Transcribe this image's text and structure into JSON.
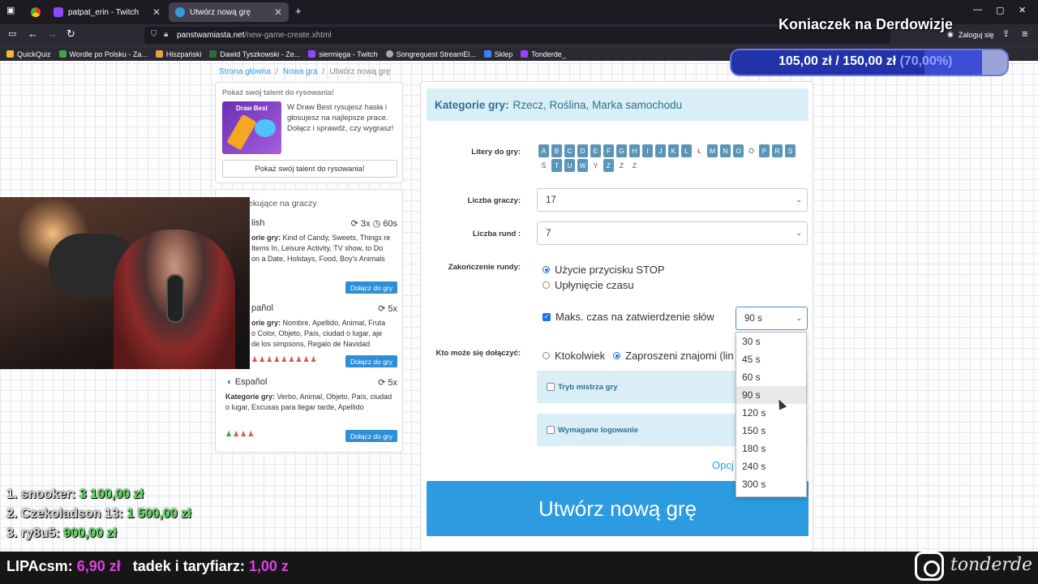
{
  "browser": {
    "tabs": [
      {
        "label": "patpat_erin - Twitch"
      },
      {
        "label": "Utwórz nową grę"
      }
    ],
    "url_host": "panstwamiasta.net",
    "url_path": "/new-game-create.xhtml",
    "login_label": "Zaloguj się",
    "bookmarks": [
      "QuickQuiz",
      "Wordle po Polsku - Za...",
      "Hiszpański",
      "Dawid Tyszkowski - Ze...",
      "siermięga - Twitch",
      "Songrequest StreamEl...",
      "Sklep",
      "Tonderde_"
    ]
  },
  "overlay": {
    "stream_title": "Koniaczek na Derdowizje",
    "goal_current": "105,00 zł",
    "goal_sep": "/",
    "goal_target": "150,00 zł",
    "goal_pct_label": "(70,00%)",
    "goal_fraction": 0.7,
    "leaderboard": [
      {
        "rank": "1.",
        "name": "snooker:",
        "amount": "3 100,00 zł"
      },
      {
        "rank": "2.",
        "name": "Czekoladson 13:",
        "amount": "1 500,00 zł"
      },
      {
        "rank": "3.",
        "name": "ry8u5:",
        "amount": "900,00 zł"
      }
    ],
    "donors": [
      {
        "name": "LIPAcsm:",
        "amount": "6,90 zł"
      },
      {
        "name": "tadek i taryfiarz:",
        "amount": "1,00 z"
      }
    ],
    "instagram": "tonderde"
  },
  "breadcrumb": [
    "Strona główna",
    "Nowa gra",
    "Utwórz nową grę"
  ],
  "promo": {
    "title": "Pokaż swój talent do rysowania!",
    "image_text": "Draw Best",
    "description": "W Draw Best rysujesz hasła i głosujesz na najlepsze prace. Dołącz i sprawdź, czy wygrasz!",
    "button": "Pokaż swój talent do rysowania!"
  },
  "games": {
    "heading": "ekujące na graczy",
    "items": [
      {
        "lang": "lish",
        "rounds": "3x",
        "time": "60s",
        "cats_label": "orie gry:",
        "cats": "Kind of Candy, Sweets, Things re Items In, Leisure Activity, TV show, to Do on a Date, Holidays, Food, Boy's Animals",
        "join": "Dołącz do gry"
      },
      {
        "lang": "pañol",
        "rounds": "5x",
        "cats_label": "orie gry:",
        "cats": "Nombre, Apellido, Animal, Fruta o Color, Objeto, País, ciudad o lugar, aje de los simpsons, Regalo de Navidad",
        "join": "Dołącz do gry"
      },
      {
        "lang": "Español",
        "rounds": "5x",
        "cats_label": "Kategorie gry:",
        "cats": "Verbo, Animal, Objeto, País, ciudad o lugar, Excusas para llegar tarde, Apellido",
        "join": "Dołącz do gry"
      }
    ]
  },
  "form": {
    "categories_label": "Kategorie gry:",
    "categories": "Rzecz, Roślina, Marka samochodu",
    "letters_label": "Litery do gry:",
    "letters": [
      {
        "l": "A",
        "on": true
      },
      {
        "l": "B",
        "on": true
      },
      {
        "l": "C",
        "on": true
      },
      {
        "l": "D",
        "on": true
      },
      {
        "l": "E",
        "on": true
      },
      {
        "l": "F",
        "on": true
      },
      {
        "l": "G",
        "on": true
      },
      {
        "l": "H",
        "on": true
      },
      {
        "l": "I",
        "on": true
      },
      {
        "l": "J",
        "on": true
      },
      {
        "l": "K",
        "on": true
      },
      {
        "l": "L",
        "on": true
      },
      {
        "l": "Ł",
        "on": false
      },
      {
        "l": "M",
        "on": true
      },
      {
        "l": "N",
        "on": true
      },
      {
        "l": "O",
        "on": true
      },
      {
        "l": "Ó",
        "on": false
      },
      {
        "l": "P",
        "on": true
      },
      {
        "l": "R",
        "on": true
      },
      {
        "l": "S",
        "on": true
      },
      {
        "l": "Ś",
        "on": false
      },
      {
        "l": "T",
        "on": true
      },
      {
        "l": "U",
        "on": true
      },
      {
        "l": "W",
        "on": true
      },
      {
        "l": "Y",
        "on": false
      },
      {
        "l": "Z",
        "on": true
      },
      {
        "l": "Ź",
        "on": false
      },
      {
        "l": "Ż",
        "on": false
      }
    ],
    "players_label": "Liczba graczy:",
    "players_value": "17",
    "rounds_label": "Liczba rund :",
    "rounds_value": "7",
    "end_label": "Zakończenie rundy:",
    "end_opt1": "Użycie przycisku STOP",
    "end_opt2": "Upłynięcie czasu",
    "max_time_label": "Maks. czas na zatwierdzenie słów",
    "max_time_value": "90 s",
    "time_options": [
      "30 s",
      "45 s",
      "60 s",
      "90 s",
      "120 s",
      "150 s",
      "180 s",
      "240 s",
      "300 s"
    ],
    "time_highlighted_index": 3,
    "join_label": "Kto może się dołączyć:",
    "join_opt1": "Ktokolwiek",
    "join_opt2": "Zaproszeni znajomi (lin",
    "gm_mode": "Tryb mistrza gry",
    "login_req": "Wymagane logowanie",
    "options_link": "Opcj",
    "create_button": "Utwórz nową grę"
  }
}
